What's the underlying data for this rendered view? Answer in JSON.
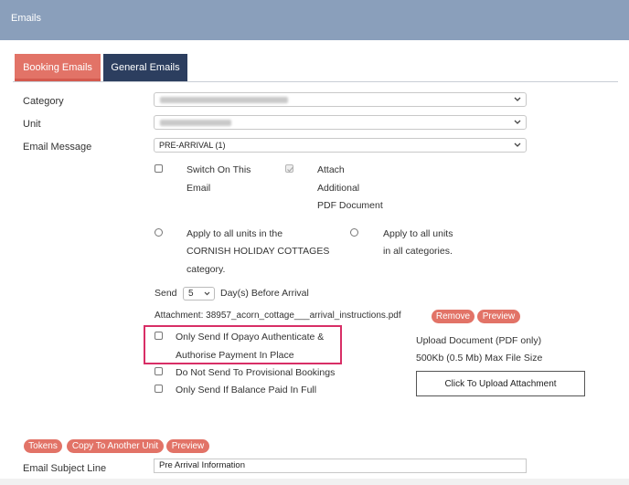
{
  "header": {
    "title": "Emails"
  },
  "tabs": [
    {
      "label": "Booking Emails",
      "active": true
    },
    {
      "label": "General Emails",
      "active": false
    }
  ],
  "form": {
    "category": {
      "label": "Category",
      "value": ""
    },
    "unit": {
      "label": "Unit",
      "value": ""
    },
    "email_message": {
      "label": "Email Message",
      "value": "PRE-ARRIVAL (1)"
    }
  },
  "options": {
    "switch_on_line1": "Switch On This",
    "switch_on_line2": "Email",
    "attach_line1": "Attach",
    "attach_line2": "Additional",
    "attach_line3": "PDF Document",
    "apply_units_line1": "Apply to all units in the",
    "apply_units_line2": "CORNISH HOLIDAY COTTAGES",
    "apply_units_line3": "category.",
    "apply_all_line1": "Apply to all units",
    "apply_all_line2": "in all categories.",
    "send_label": "Send",
    "send_days": "5",
    "days_before_label": "Day(s) Before Arrival",
    "attachment_text": "Attachment: 38957_acorn_cottage___arrival_instructions.pdf",
    "remove_label": "Remove",
    "preview_label": "Preview",
    "opayo_line1": "Only Send If Opayo Authenticate &",
    "opayo_line2": "Authorise Payment In Place",
    "no_provisional": "Do Not Send To Provisional Bookings",
    "balance_paid": "Only Send If Balance Paid In Full"
  },
  "upload": {
    "title": "Upload Document (PDF only)",
    "max_size": "500Kb (0.5 Mb) Max File Size",
    "button": "Click To Upload Attachment"
  },
  "bottom": {
    "tokens": "Tokens",
    "copy": "Copy To Another Unit",
    "preview": "Preview",
    "subject_label": "Email Subject Line",
    "subject_value": "Pre Arrival Information"
  },
  "colors": {
    "header": "#8a9fbb",
    "accent": "#e27367",
    "dark_tab": "#2c3e5f",
    "highlight": "#d82e66"
  }
}
